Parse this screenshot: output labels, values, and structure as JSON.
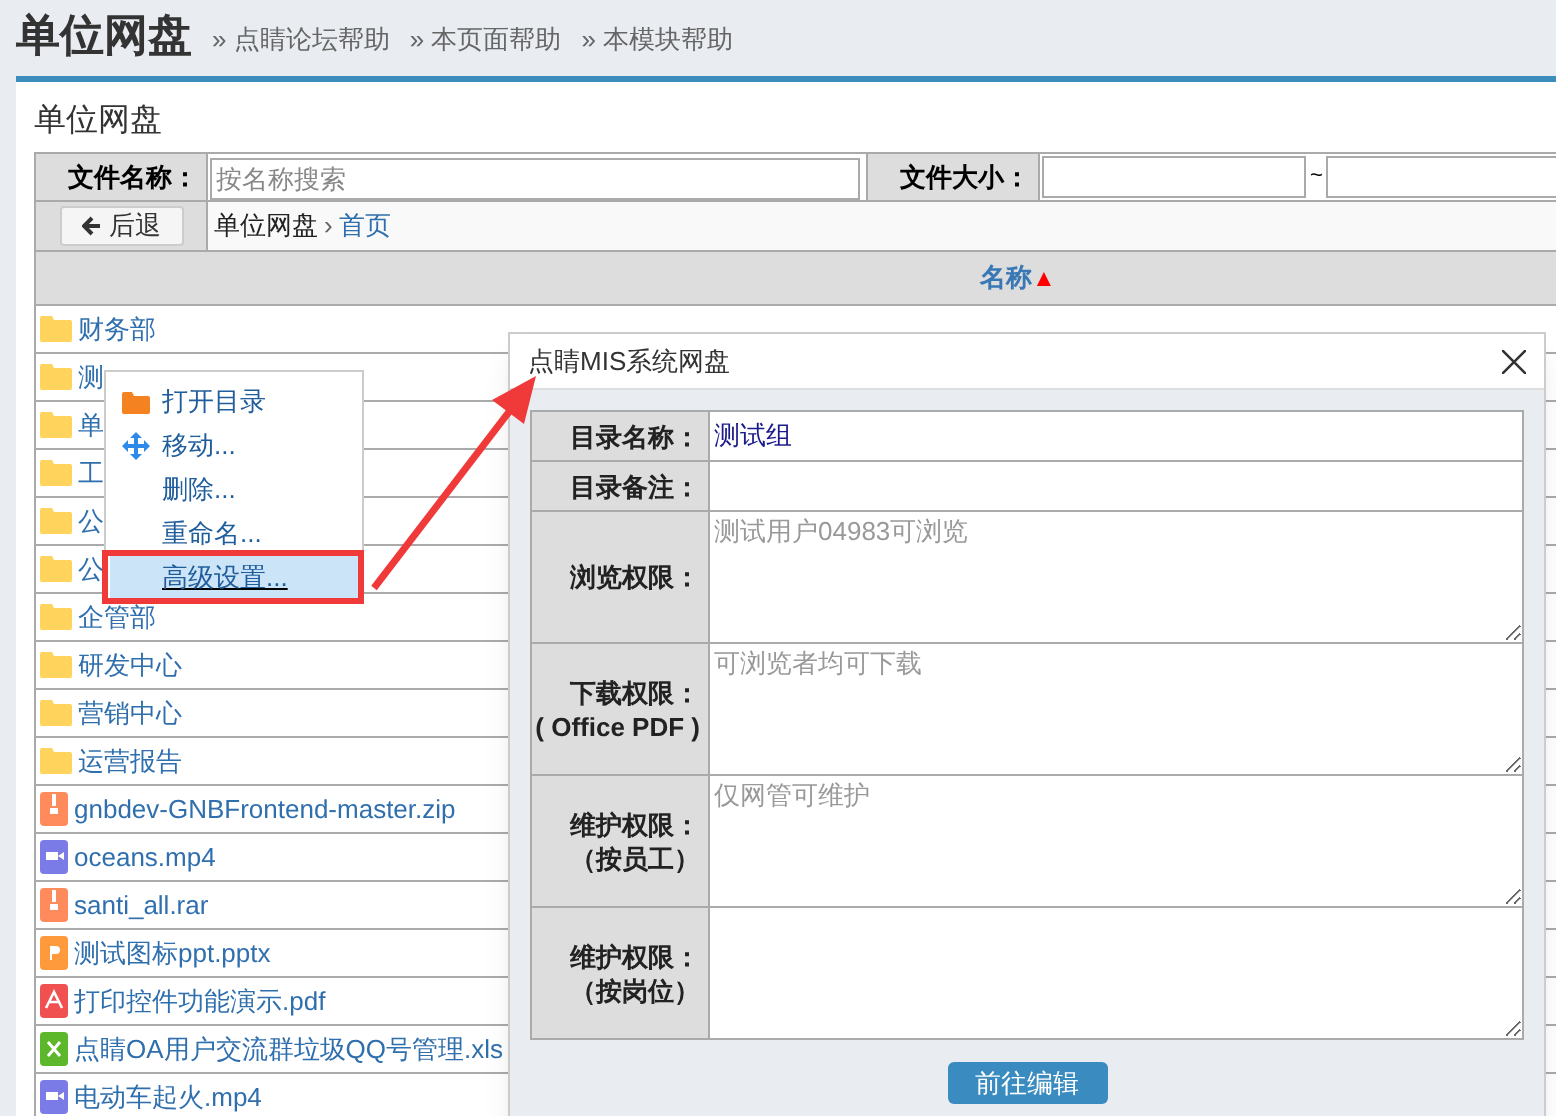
{
  "page_title": "单位网盘",
  "help_links": [
    "» 点睛论坛帮助",
    "» 本页面帮助",
    "» 本模块帮助"
  ],
  "panel_title": "单位网盘",
  "filters": {
    "name_label": "文件名称：",
    "name_placeholder": "按名称搜索",
    "size_label": "文件大小：",
    "range_separator": "~"
  },
  "back_button": "后退",
  "breadcrumb_separator": "›",
  "breadcrumb": [
    {
      "label": "单位网盘",
      "link": false
    },
    {
      "label": "首页",
      "link": true
    }
  ],
  "table": {
    "columns": [
      {
        "label": "名称",
        "sort_mark": "▲"
      }
    ],
    "rows": [
      {
        "kind": "folder",
        "name": "财务部"
      },
      {
        "kind": "folder",
        "name": "测"
      },
      {
        "kind": "folder",
        "name": "单"
      },
      {
        "kind": "folder",
        "name": "工"
      },
      {
        "kind": "folder",
        "name": "公"
      },
      {
        "kind": "folder",
        "name": "公"
      },
      {
        "kind": "folder",
        "name": "企管部"
      },
      {
        "kind": "folder",
        "name": "研发中心"
      },
      {
        "kind": "folder",
        "name": "营销中心"
      },
      {
        "kind": "folder",
        "name": "运营报告"
      },
      {
        "kind": "archive",
        "name": "gnbdev-GNBFrontend-master.zip"
      },
      {
        "kind": "video",
        "name": "oceans.mp4"
      },
      {
        "kind": "archive",
        "name": "santi_all.rar"
      },
      {
        "kind": "slides",
        "name": "测试图标ppt.pptx"
      },
      {
        "kind": "pdf",
        "name": "打印控件功能演示.pdf"
      },
      {
        "kind": "sheet",
        "name": "点睛OA用户交流群垃圾QQ号管理.xls"
      },
      {
        "kind": "video",
        "name": "电动车起火.mp4"
      }
    ]
  },
  "context_menu": [
    {
      "kind": "open",
      "label": "打开目录",
      "selected": false
    },
    {
      "kind": "move",
      "label": "移动...",
      "selected": false
    },
    {
      "kind": "plain",
      "label": "删除...",
      "selected": false
    },
    {
      "kind": "plain",
      "label": "重命名...",
      "selected": false
    },
    {
      "kind": "plain",
      "label": "高级设置...",
      "selected": true
    }
  ],
  "dialog": {
    "title": "点睛MIS系统网盘",
    "fields": [
      {
        "kind": "line",
        "label": "目录名称：",
        "value": "测试组"
      },
      {
        "kind": "line",
        "label": "目录备注："
      },
      {
        "kind": "area",
        "label": "浏览权限：",
        "placeholder": "测试用户04983可浏览"
      },
      {
        "kind": "area",
        "label": [
          "下载权限：",
          "( Office PDF )"
        ],
        "placeholder": "可浏览者均可下载"
      },
      {
        "kind": "area",
        "label": [
          "维护权限：",
          "（按员工）"
        ],
        "placeholder": "仅网管可维护"
      },
      {
        "kind": "area",
        "label": [
          "维护权限：",
          "（按岗位）"
        ]
      }
    ],
    "button": "前往编辑"
  }
}
